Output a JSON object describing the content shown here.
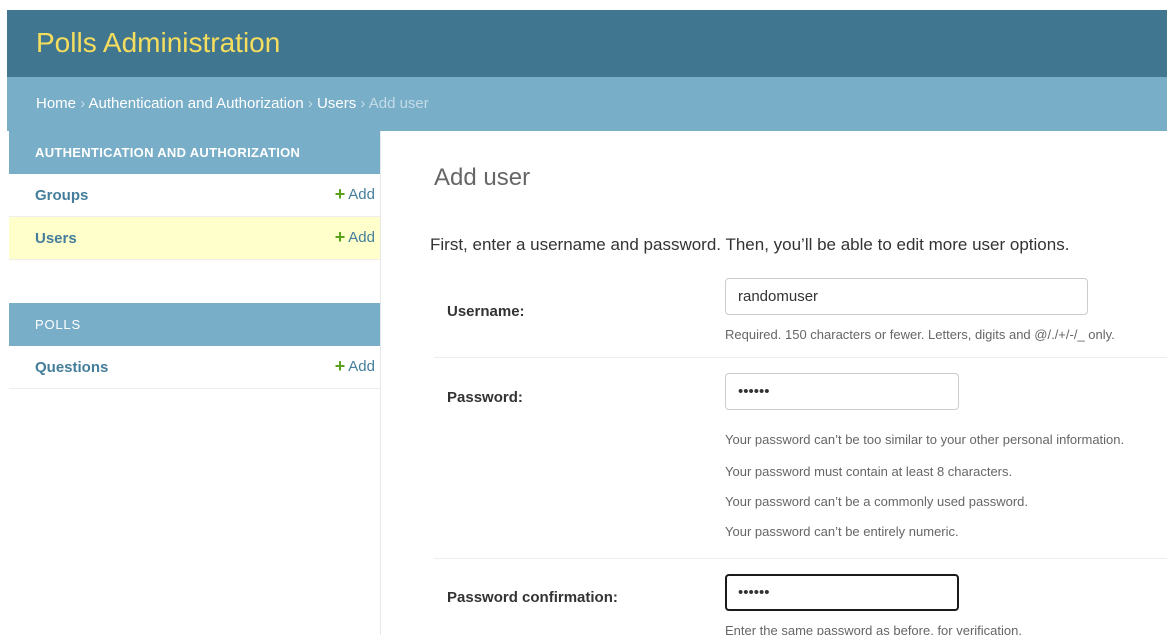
{
  "header": {
    "site_title": "Polls Administration"
  },
  "breadcrumbs": {
    "home": "Home",
    "separator": "›",
    "app": "Authentication and Authorization",
    "model": "Users",
    "current": "Add user"
  },
  "sidebar": {
    "modules": [
      {
        "caption": "AUTHENTICATION AND AUTHORIZATION",
        "models": [
          {
            "name": "Groups",
            "add_label": "Add",
            "selected": false
          },
          {
            "name": "Users",
            "add_label": "Add",
            "selected": true
          }
        ]
      },
      {
        "caption": "POLLS",
        "models": [
          {
            "name": "Questions",
            "add_label": "Add",
            "selected": false
          }
        ]
      }
    ]
  },
  "main": {
    "title": "Add user",
    "intro": "First, enter a username and password. Then, you’ll be able to edit more user options.",
    "fields": {
      "username": {
        "label": "Username:",
        "value": "randomuser",
        "help": "Required. 150 characters or fewer. Letters, digits and @/./+/-/_ only."
      },
      "password1": {
        "label": "Password:",
        "value": "••••••",
        "help": [
          "Your password can’t be too similar to your other personal information.",
          "Your password must contain at least 8 characters.",
          "Your password can’t be a commonly used password.",
          "Your password can’t be entirely numeric."
        ]
      },
      "password2": {
        "label": "Password confirmation:",
        "value": "••••••",
        "help": "Enter the same password as before, for verification."
      }
    }
  },
  "colors": {
    "header_bg": "#417690",
    "site_title": "#f5dd5d",
    "breadcrumbs_bg": "#79aec8",
    "link": "#447e9b",
    "add_icon": "#5aa21c",
    "selected_row": "#ffffcc"
  },
  "icons": {
    "add": "plus-icon"
  }
}
